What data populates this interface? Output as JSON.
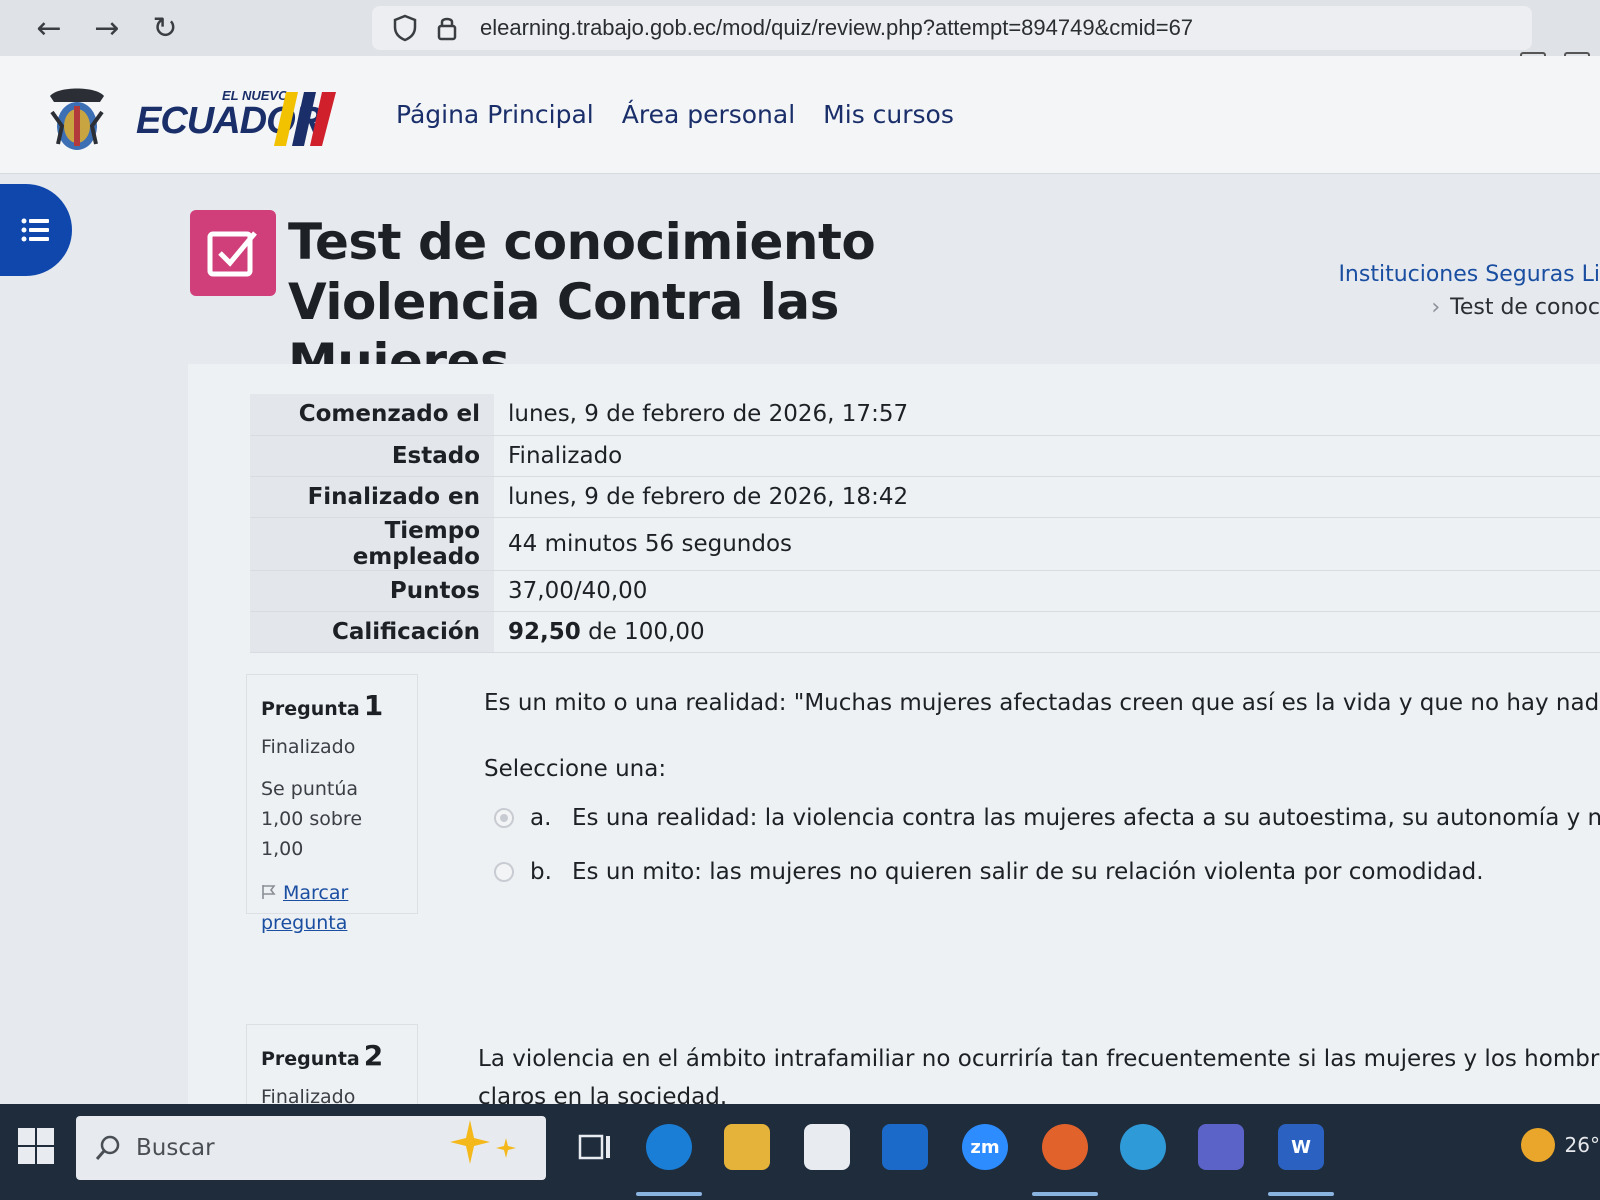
{
  "browser": {
    "url": "elearning.trabajo.gob.ec/mod/quiz/review.php?attempt=894749&cmid=67",
    "back_label": "←",
    "forward_label": "→",
    "reload_label": "↻"
  },
  "site": {
    "brand_small": "EL NUEVO",
    "brand_word": "ECUADOR",
    "nav": [
      "Página Principal",
      "Área personal",
      "Mis cursos"
    ]
  },
  "page": {
    "title": "Test de conocimiento Violencia Contra las Mujeres",
    "breadcrumb": [
      "Instituciones Seguras Li",
      "Test de conoc"
    ]
  },
  "summary": {
    "rows": [
      {
        "label": "Comenzado el",
        "value": "lunes, 9 de febrero de 2026, 17:57"
      },
      {
        "label": "Estado",
        "value": "Finalizado"
      },
      {
        "label": "Finalizado en",
        "value": "lunes, 9 de febrero de 2026, 18:42"
      },
      {
        "label": "Tiempo empleado",
        "value": "44 minutos 56 segundos"
      },
      {
        "label": "Puntos",
        "value": "37,00/40,00"
      }
    ],
    "grade_label": "Calificación",
    "grade_value": "92,50",
    "grade_suffix": "de 100,00"
  },
  "questions": [
    {
      "label": "Pregunta",
      "number": "1",
      "state": "Finalizado",
      "grade": "Se puntúa 1,00 sobre 1,00",
      "flag": "Marcar pregunta",
      "text": "Es un mito o una realidad: \"Muchas mujeres afectadas creen que así es la vida y que no hay nada que ha",
      "prompt": "Seleccione una:",
      "answers": [
        {
          "letter": "a.",
          "text": "Es una realidad: la violencia contra las mujeres afecta a su autoestima, su autonomía y no ven ur"
        },
        {
          "letter": "b.",
          "text": "Es un mito: las mujeres no quieren salir de su relación violenta por comodidad."
        }
      ]
    },
    {
      "label": "Pregunta",
      "number": "2",
      "state": "Finalizado",
      "text_line1": "La violencia en el ámbito intrafamiliar no ocurriría tan frecuentemente si las mujeres y los hombres tuviera",
      "text_line2": "claros en la sociedad."
    }
  ],
  "taskbar": {
    "search_placeholder": "Buscar",
    "zoom_label": "zm",
    "word_label": "W",
    "temperature": "26°"
  },
  "colors": {
    "accent": "#0f47ad",
    "quiz_icon": "#d13f7b",
    "link": "#1a4ea1"
  }
}
